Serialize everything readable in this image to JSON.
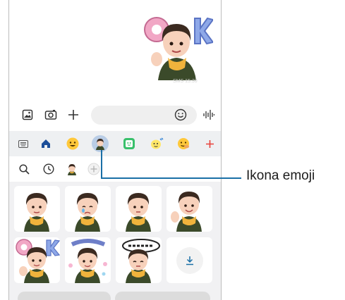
{
  "chat": {
    "time": "SMS 15:30"
  },
  "icons": {
    "gallery": "gallery-icon",
    "camera": "camera-icon",
    "add": "plus-icon",
    "emoji": "smiley-icon",
    "voice": "voice-wave-icon",
    "search": "search-icon",
    "recent": "clock-icon",
    "download": "download-icon"
  },
  "category_tabs": [
    "keyboard",
    "home",
    "emoji",
    "ar-emoji",
    "sticker",
    "bitmoji",
    "animated-emoji",
    "add"
  ],
  "colors": {
    "accent": "#1a6fa6",
    "add_red": "#e8413a",
    "selected": "#b9cde6",
    "category_bg": "#eef0f2"
  },
  "callout": {
    "label": "Ikona emoji"
  }
}
